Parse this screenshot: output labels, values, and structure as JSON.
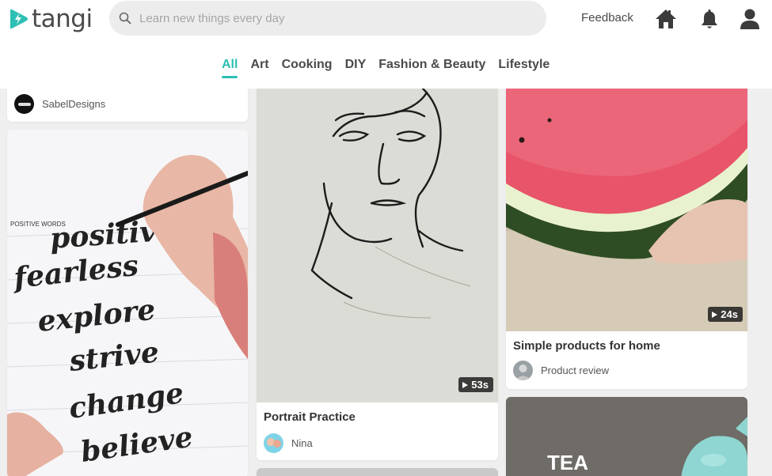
{
  "brand": {
    "name": "tangi",
    "accent": "#2dbfb3"
  },
  "search": {
    "placeholder": "Learn new things every day"
  },
  "header": {
    "feedback_label": "Feedback",
    "icons": [
      "home-icon",
      "bell-icon",
      "user-icon"
    ]
  },
  "tabs": [
    {
      "label": "All",
      "active": true
    },
    {
      "label": "Art",
      "active": false
    },
    {
      "label": "Cooking",
      "active": false
    },
    {
      "label": "DIY",
      "active": false
    },
    {
      "label": "Fashion & Beauty",
      "active": false
    },
    {
      "label": "Lifestyle",
      "active": false
    }
  ],
  "cards": [
    {
      "title": "",
      "author": "SabelDesigns",
      "duration": ""
    },
    {
      "title": "",
      "author": "",
      "duration": ""
    },
    {
      "title": "Portrait Practice",
      "author": "Nina",
      "duration": "53s"
    },
    {
      "title": "Simple products for home",
      "author": "Product review",
      "duration": "24s"
    },
    {
      "title": "",
      "author": "",
      "duration": ""
    },
    {
      "title": "",
      "author": "",
      "duration": ""
    }
  ],
  "thumbs": {
    "calligraphy_words": [
      "positive",
      "fearless",
      "explore",
      "strive",
      "change",
      "believe"
    ],
    "calligraphy_header": "POSITIVE WORDS",
    "tea_text": "TEA"
  }
}
